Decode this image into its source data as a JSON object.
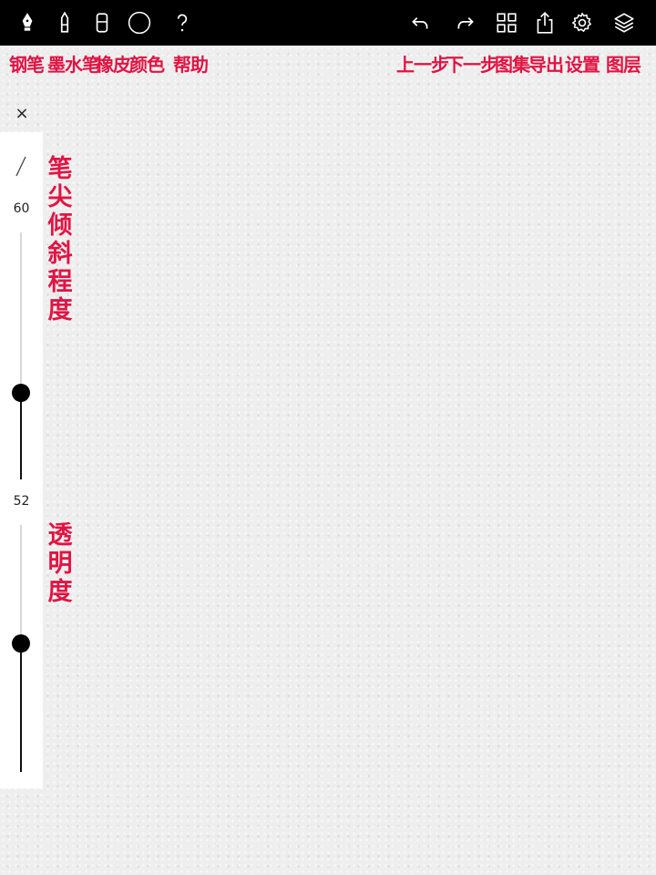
{
  "toolbar": {
    "left_tools": [
      "pen-nib-icon",
      "ink-pen-icon",
      "eraser-icon",
      "color-circle-icon",
      "help-icon"
    ],
    "right_tools": [
      "undo-icon",
      "redo-icon",
      "gallery-grid-icon",
      "share-icon",
      "gear-icon",
      "layers-icon"
    ]
  },
  "annotations": {
    "fountain_pen": "钢笔",
    "ink_pen": "墨水笔",
    "eraser": "橡皮",
    "color": "颜色",
    "help": "帮助",
    "undo": "上一步",
    "redo": "下一步",
    "gallery": "图集",
    "export": "导出",
    "settings": "设置",
    "layers": "图层"
  },
  "side_panel": {
    "close_symbol": "×",
    "tilt": {
      "value": "60",
      "label": "笔尖倾斜程度",
      "level": 0.35
    },
    "opacity": {
      "value": "52",
      "label": "透明度",
      "level": 0.52
    }
  },
  "colors": {
    "annotation": "#e11443",
    "toolbar_bg": "#000000"
  }
}
